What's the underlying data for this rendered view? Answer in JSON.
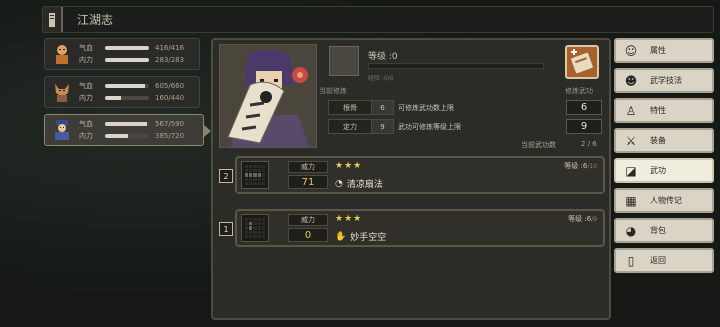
{
  "title": {
    "tab_icon": "book-icon",
    "text": "江湖志"
  },
  "members": [
    {
      "avatar": "monk-icon",
      "hp_label": "气血",
      "hp_text": "416/416",
      "hp": 1.0,
      "mp_label": "内力",
      "mp_text": "283/283",
      "mp": 1.0
    },
    {
      "avatar": "fox-icon",
      "hp_label": "气血",
      "hp_text": "605/660",
      "hp": 0.92,
      "mp_label": "内力",
      "mp_text": "160/440",
      "mp": 0.36
    },
    {
      "avatar": "mage-icon",
      "hp_label": "气血",
      "hp_text": "567/590",
      "hp": 0.96,
      "mp_label": "内力",
      "mp_text": "385/720",
      "mp": 0.53
    }
  ],
  "panel": {
    "current_label": "当前修炼",
    "level_label": "等级 :0",
    "exp_text": "经验 :0/0",
    "practice_label": "修炼武功",
    "rows": [
      {
        "key": "根骨",
        "num": "6",
        "desc": "可修炼武功数上限",
        "val": "6"
      },
      {
        "key": "定力",
        "num": "9",
        "desc": "武功可修炼等级上限",
        "val": "9"
      }
    ],
    "learned_label": "当前武功数",
    "learned_count": "2 / 6"
  },
  "skills": [
    {
      "badge": "2",
      "power_label": "威力",
      "power": "71",
      "stars": "★★★",
      "name": "清凉扇法",
      "level": "等级 :6",
      "level_max": "/10"
    },
    {
      "badge": "1",
      "power_label": "威力",
      "power": "0",
      "stars": "★★★",
      "name": "妙手空空",
      "level": "等级 :6",
      "level_max": "/9"
    }
  ],
  "menu": [
    {
      "label": "属性",
      "icon": "attribute-icon"
    },
    {
      "label": "武学技法",
      "icon": "technique-icon"
    },
    {
      "label": "特性",
      "icon": "trait-icon"
    },
    {
      "label": "装备",
      "icon": "sword-icon"
    },
    {
      "label": "武功",
      "icon": "martial-book-icon",
      "active": true
    },
    {
      "label": "人物传记",
      "icon": "biography-icon"
    },
    {
      "label": "背包",
      "icon": "bag-icon"
    },
    {
      "label": "返回",
      "icon": "return-icon"
    }
  ]
}
